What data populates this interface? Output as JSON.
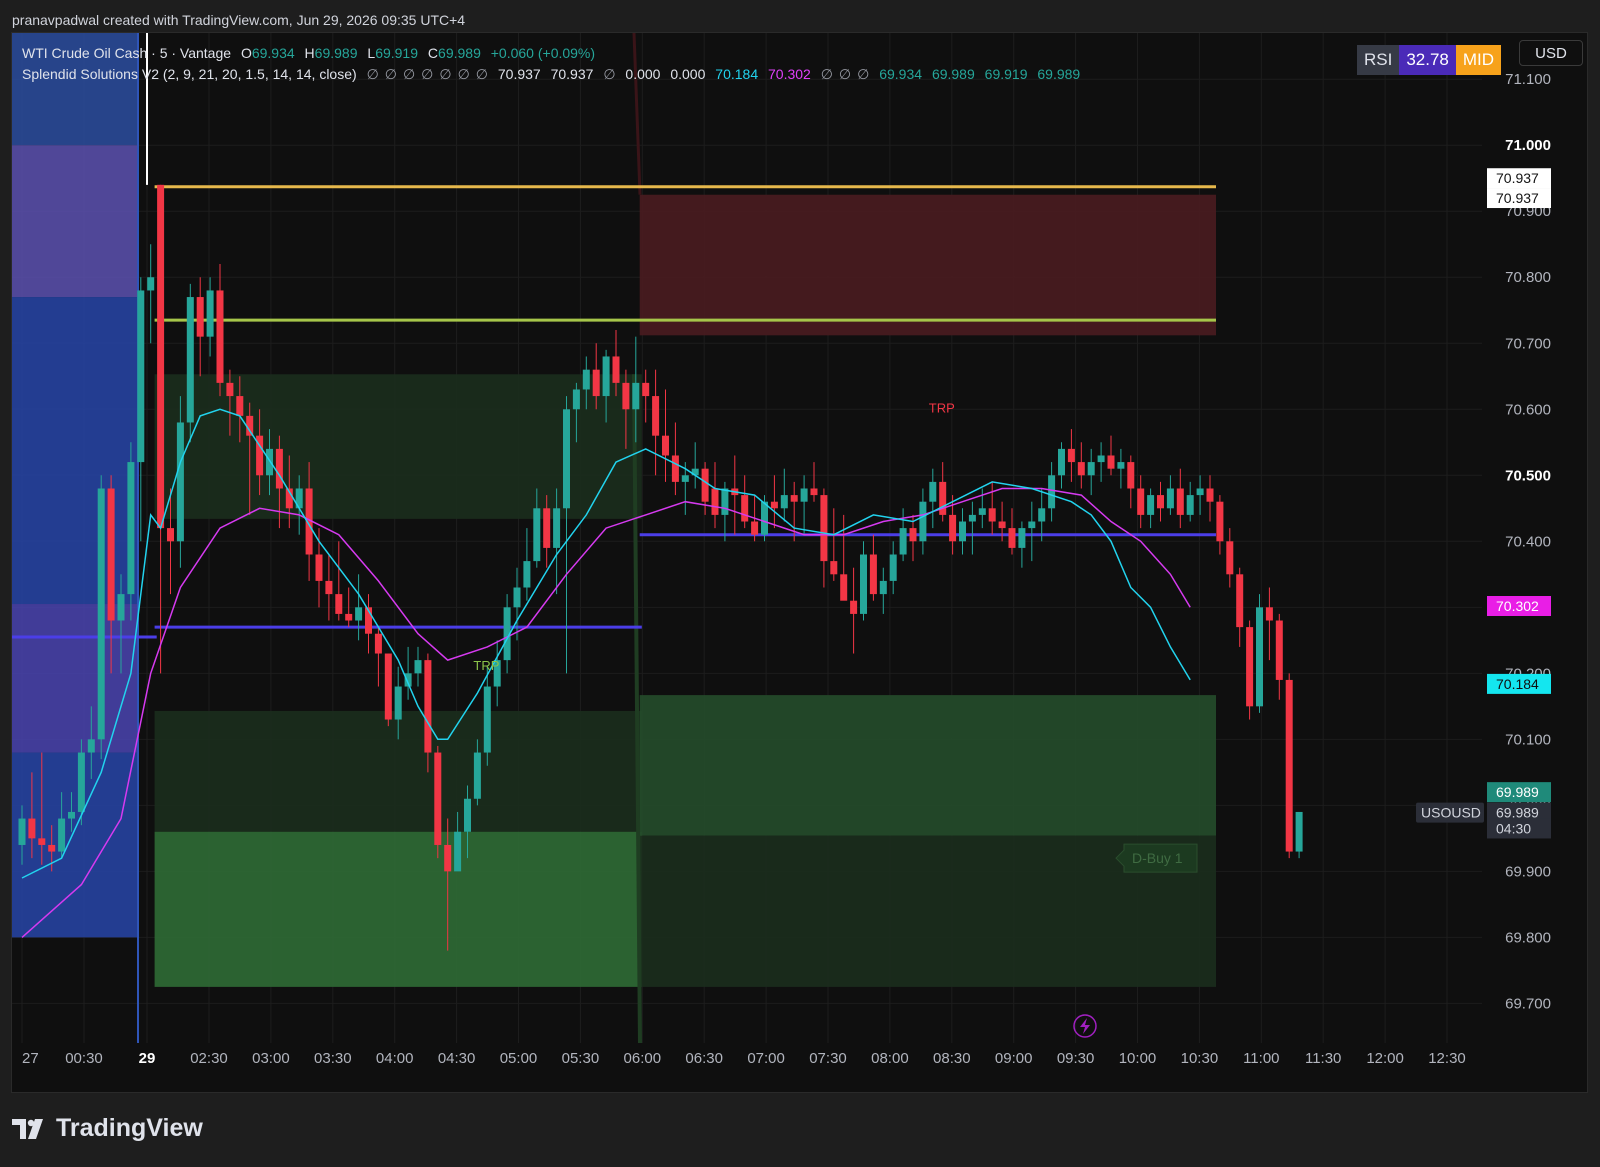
{
  "header": {
    "attribution": "pranavpadwal created with TradingView.com, Jun 29, 2026 09:35 UTC+4"
  },
  "legend": {
    "symbol": "WTI Crude Oil Cash · 5 · Vantage",
    "o_label": "O",
    "o": "69.934",
    "h_label": "H",
    "h": "69.989",
    "l_label": "L",
    "l": "69.919",
    "c_label": "C",
    "c": "69.989",
    "change": "+0.060 (+0.09%)",
    "indicator": "Splendid Solutions V2 (2, 9, 21, 20, 1.5, 14, 14, close)",
    "na": "∅",
    "v1": "70.937",
    "v2": "70.937",
    "v3": "0.000",
    "v4": "0.000",
    "v5": "70.184",
    "v6": "70.302",
    "v7": "69.934",
    "v8": "69.989",
    "v9": "69.919",
    "v10": "69.989"
  },
  "rsi_badge": {
    "label": "RSI",
    "value": "32.78",
    "state": "MID"
  },
  "currency_button": "USD",
  "brand": "TradingView",
  "colors": {
    "up": "#26a69a",
    "down": "#f23645",
    "ema_fast": "#22d3ee",
    "ema_slow": "#d63af0",
    "supply": "#4a1c20",
    "demand": "#2f6b35",
    "level_gold": "#e6b84c",
    "level_lime": "#a6c64a",
    "level_blue": "#4b3ee8"
  },
  "chart_data": {
    "type": "candlestick",
    "symbol": "USOUSD",
    "y_axis": {
      "ylim": [
        69.64,
        71.17
      ],
      "ticks": [
        "71.100",
        "71.000",
        "70.900",
        "70.800",
        "70.700",
        "70.600",
        "70.500",
        "70.400",
        "70.300",
        "70.200",
        "70.100",
        "70.000",
        "69.900",
        "69.800",
        "69.700"
      ]
    },
    "x_axis": {
      "ticks": [
        "27",
        "00:30",
        "29",
        "02:30",
        "03:00",
        "03:30",
        "04:00",
        "04:30",
        "05:00",
        "05:30",
        "06:00",
        "06:30",
        "07:00",
        "07:30",
        "08:00",
        "08:30",
        "09:00",
        "09:30",
        "10:00",
        "10:30",
        "11:00",
        "11:30",
        "12:00",
        "12:30"
      ]
    },
    "candles": [
      [
        69.94,
        70.0,
        69.91,
        69.98
      ],
      [
        69.98,
        70.05,
        69.92,
        69.95
      ],
      [
        69.95,
        70.08,
        69.91,
        69.94
      ],
      [
        69.94,
        69.97,
        69.9,
        69.93
      ],
      [
        69.93,
        70.02,
        69.92,
        69.98
      ],
      [
        69.98,
        70.02,
        69.96,
        69.99
      ],
      [
        69.99,
        70.1,
        69.97,
        70.08
      ],
      [
        70.08,
        70.15,
        70.04,
        70.1
      ],
      [
        70.1,
        70.5,
        70.07,
        70.48
      ],
      [
        70.48,
        70.5,
        70.2,
        70.28
      ],
      [
        70.28,
        70.35,
        70.2,
        70.32
      ],
      [
        70.32,
        70.55,
        70.28,
        70.52
      ],
      [
        70.52,
        70.8,
        70.4,
        70.78
      ],
      [
        70.78,
        70.85,
        70.7,
        70.8
      ],
      [
        70.94,
        70.94,
        70.2,
        70.42
      ],
      [
        70.42,
        70.48,
        70.32,
        70.4
      ],
      [
        70.4,
        70.62,
        70.36,
        70.58
      ],
      [
        70.58,
        70.79,
        70.55,
        70.77
      ],
      [
        70.77,
        70.8,
        70.65,
        70.71
      ],
      [
        70.71,
        70.8,
        70.68,
        70.78
      ],
      [
        70.78,
        70.82,
        70.62,
        70.64
      ],
      [
        70.64,
        70.66,
        70.56,
        70.62
      ],
      [
        70.62,
        70.65,
        70.55,
        70.59
      ],
      [
        70.59,
        70.61,
        70.44,
        70.56
      ],
      [
        70.56,
        70.6,
        70.47,
        70.5
      ],
      [
        70.5,
        70.57,
        70.47,
        70.54
      ],
      [
        70.54,
        70.56,
        70.42,
        70.48
      ],
      [
        70.48,
        70.53,
        70.42,
        70.45
      ],
      [
        70.45,
        70.5,
        70.41,
        70.48
      ],
      [
        70.48,
        70.52,
        70.34,
        70.38
      ],
      [
        70.38,
        70.42,
        70.3,
        70.34
      ],
      [
        70.34,
        70.38,
        70.28,
        70.32
      ],
      [
        70.32,
        70.4,
        70.28,
        70.29
      ],
      [
        70.29,
        70.33,
        70.27,
        70.28
      ],
      [
        70.28,
        70.35,
        70.25,
        70.3
      ],
      [
        70.3,
        70.32,
        70.23,
        70.26
      ],
      [
        70.26,
        70.27,
        70.18,
        70.23
      ],
      [
        70.23,
        70.23,
        70.12,
        70.13
      ],
      [
        70.13,
        70.21,
        70.1,
        70.18
      ],
      [
        70.18,
        70.24,
        70.16,
        70.2
      ],
      [
        70.2,
        70.24,
        70.18,
        70.22
      ],
      [
        70.22,
        70.23,
        70.05,
        70.08
      ],
      [
        70.08,
        70.09,
        69.92,
        69.94
      ],
      [
        69.94,
        69.98,
        69.78,
        69.9
      ],
      [
        69.9,
        69.99,
        69.92,
        69.96
      ],
      [
        69.96,
        70.03,
        69.92,
        70.01
      ],
      [
        70.01,
        70.1,
        70.0,
        70.08
      ],
      [
        70.08,
        70.21,
        70.06,
        70.18
      ],
      [
        70.18,
        70.25,
        70.15,
        70.22
      ],
      [
        70.22,
        70.32,
        70.2,
        70.3
      ],
      [
        70.3,
        70.36,
        70.25,
        70.33
      ],
      [
        70.33,
        70.42,
        70.31,
        70.37
      ],
      [
        70.37,
        70.48,
        70.36,
        70.45
      ],
      [
        70.45,
        70.47,
        70.36,
        70.39
      ],
      [
        70.39,
        70.48,
        70.32,
        70.45
      ],
      [
        70.45,
        70.62,
        70.2,
        70.6
      ],
      [
        70.6,
        70.64,
        70.55,
        70.63
      ],
      [
        70.63,
        70.68,
        70.6,
        70.66
      ],
      [
        70.66,
        70.7,
        70.6,
        70.62
      ],
      [
        70.62,
        70.69,
        70.58,
        70.68
      ],
      [
        70.68,
        70.72,
        70.62,
        70.64
      ],
      [
        70.64,
        70.66,
        70.54,
        70.6
      ],
      [
        70.6,
        70.71,
        70.55,
        70.64
      ],
      [
        70.64,
        70.66,
        70.58,
        70.62
      ],
      [
        70.62,
        70.66,
        70.5,
        70.56
      ],
      [
        70.56,
        70.63,
        70.49,
        70.53
      ],
      [
        70.53,
        70.58,
        70.47,
        70.49
      ],
      [
        70.49,
        70.52,
        70.44,
        70.5
      ],
      [
        70.5,
        70.55,
        70.48,
        70.51
      ],
      [
        70.51,
        70.52,
        70.44,
        70.46
      ],
      [
        70.48,
        70.52,
        70.42,
        70.44
      ],
      [
        70.44,
        70.49,
        70.4,
        70.48
      ],
      [
        70.48,
        70.53,
        70.41,
        70.47
      ],
      [
        70.47,
        70.5,
        70.42,
        70.43
      ],
      [
        70.43,
        70.47,
        70.4,
        70.41
      ],
      [
        70.41,
        70.47,
        70.4,
        70.46
      ],
      [
        70.46,
        70.5,
        70.42,
        70.45
      ],
      [
        70.45,
        70.51,
        70.43,
        70.47
      ],
      [
        70.47,
        70.49,
        70.4,
        70.46
      ],
      [
        70.46,
        70.5,
        70.41,
        70.48
      ],
      [
        70.48,
        70.52,
        70.46,
        70.47
      ],
      [
        70.47,
        70.48,
        70.33,
        70.37
      ],
      [
        70.37,
        70.45,
        70.34,
        70.35
      ],
      [
        70.35,
        70.44,
        70.32,
        70.31
      ],
      [
        70.31,
        70.36,
        70.23,
        70.29
      ],
      [
        70.29,
        70.4,
        70.28,
        70.38
      ],
      [
        70.38,
        70.41,
        70.31,
        70.32
      ],
      [
        70.32,
        70.36,
        70.29,
        70.34
      ],
      [
        70.34,
        70.4,
        70.32,
        70.38
      ],
      [
        70.38,
        70.45,
        70.37,
        70.42
      ],
      [
        70.42,
        70.44,
        70.37,
        70.4
      ],
      [
        70.4,
        70.48,
        70.38,
        70.46
      ],
      [
        70.46,
        70.51,
        70.42,
        70.49
      ],
      [
        70.49,
        70.52,
        70.43,
        70.44
      ],
      [
        70.44,
        70.47,
        70.38,
        70.4
      ],
      [
        70.4,
        70.45,
        70.38,
        70.43
      ],
      [
        70.43,
        70.46,
        70.38,
        70.44
      ],
      [
        70.44,
        70.48,
        70.42,
        70.45
      ],
      [
        70.45,
        70.49,
        70.41,
        70.43
      ],
      [
        70.43,
        70.46,
        70.4,
        70.42
      ],
      [
        70.42,
        70.45,
        70.38,
        70.39
      ],
      [
        70.39,
        70.43,
        70.36,
        70.42
      ],
      [
        70.42,
        70.46,
        70.37,
        70.43
      ],
      [
        70.43,
        70.48,
        70.4,
        70.45
      ],
      [
        70.45,
        70.52,
        70.43,
        70.5
      ],
      [
        70.5,
        70.55,
        70.48,
        70.54
      ],
      [
        70.54,
        70.57,
        70.49,
        70.52
      ],
      [
        70.52,
        70.55,
        70.48,
        70.5
      ],
      [
        70.5,
        70.54,
        70.47,
        70.52
      ],
      [
        70.52,
        70.55,
        70.49,
        70.53
      ],
      [
        70.53,
        70.56,
        70.5,
        70.51
      ],
      [
        70.51,
        70.54,
        70.48,
        70.52
      ],
      [
        70.52,
        70.53,
        70.45,
        70.48
      ],
      [
        70.48,
        70.5,
        70.42,
        70.44
      ],
      [
        70.44,
        70.48,
        70.42,
        70.47
      ],
      [
        70.47,
        70.49,
        70.43,
        70.45
      ],
      [
        70.45,
        70.5,
        70.44,
        70.48
      ],
      [
        70.48,
        70.51,
        70.42,
        70.44
      ],
      [
        70.44,
        70.49,
        70.43,
        70.47
      ],
      [
        70.47,
        70.5,
        70.44,
        70.48
      ],
      [
        70.48,
        70.5,
        70.43,
        70.46
      ],
      [
        70.46,
        70.47,
        70.38,
        70.4
      ],
      [
        70.4,
        70.42,
        70.33,
        70.35
      ],
      [
        70.35,
        70.36,
        70.24,
        70.27
      ],
      [
        70.27,
        70.28,
        70.13,
        70.15
      ],
      [
        70.15,
        70.32,
        70.14,
        70.3
      ],
      [
        70.3,
        70.33,
        70.22,
        70.28
      ],
      [
        70.28,
        70.29,
        70.16,
        70.19
      ],
      [
        70.19,
        70.2,
        69.92,
        69.93
      ],
      [
        69.93,
        69.99,
        69.92,
        69.99
      ]
    ],
    "ema_fast": [
      [
        0,
        69.89
      ],
      [
        4,
        69.92
      ],
      [
        8,
        70.05
      ],
      [
        11,
        70.2
      ],
      [
        13,
        70.44
      ],
      [
        14,
        70.42
      ],
      [
        16,
        70.52
      ],
      [
        18,
        70.59
      ],
      [
        20,
        70.6
      ],
      [
        22,
        70.59
      ],
      [
        26,
        70.5
      ],
      [
        30,
        70.4
      ],
      [
        34,
        70.32
      ],
      [
        38,
        70.22
      ],
      [
        40,
        70.15
      ],
      [
        42,
        70.1
      ],
      [
        43,
        70.1
      ],
      [
        46,
        70.17
      ],
      [
        50,
        70.28
      ],
      [
        54,
        70.38
      ],
      [
        57,
        70.44
      ],
      [
        60,
        70.52
      ],
      [
        63,
        70.54
      ],
      [
        67,
        70.51
      ],
      [
        70,
        70.48
      ],
      [
        74,
        70.47
      ],
      [
        78,
        70.42
      ],
      [
        82,
        70.41
      ],
      [
        86,
        70.44
      ],
      [
        90,
        70.43
      ],
      [
        94,
        70.46
      ],
      [
        98,
        70.49
      ],
      [
        102,
        70.48
      ],
      [
        106,
        70.46
      ],
      [
        108,
        70.44
      ],
      [
        110,
        70.4
      ],
      [
        112,
        70.33
      ],
      [
        114,
        70.3
      ],
      [
        116,
        70.24
      ],
      [
        118,
        70.19
      ]
    ],
    "ema_slow": [
      [
        0,
        69.8
      ],
      [
        6,
        69.88
      ],
      [
        10,
        69.98
      ],
      [
        13,
        70.2
      ],
      [
        16,
        70.33
      ],
      [
        20,
        70.42
      ],
      [
        24,
        70.45
      ],
      [
        28,
        70.44
      ],
      [
        32,
        70.41
      ],
      [
        36,
        70.34
      ],
      [
        40,
        70.26
      ],
      [
        43,
        70.22
      ],
      [
        47,
        70.24
      ],
      [
        51,
        70.27
      ],
      [
        55,
        70.35
      ],
      [
        59,
        70.42
      ],
      [
        63,
        70.44
      ],
      [
        67,
        70.46
      ],
      [
        71,
        70.45
      ],
      [
        75,
        70.43
      ],
      [
        79,
        70.41
      ],
      [
        83,
        70.41
      ],
      [
        87,
        70.43
      ],
      [
        91,
        70.44
      ],
      [
        95,
        70.46
      ],
      [
        99,
        70.48
      ],
      [
        103,
        70.48
      ],
      [
        107,
        70.47
      ],
      [
        110,
        70.43
      ],
      [
        113,
        70.4
      ],
      [
        116,
        70.35
      ],
      [
        118,
        70.3
      ]
    ],
    "price_tags": [
      {
        "text": "70.937",
        "value": 70.95,
        "kind": "white"
      },
      {
        "text": "70.937",
        "value": 70.92,
        "kind": "white"
      },
      {
        "text": "70.302",
        "value": 70.302,
        "kind": "magenta"
      },
      {
        "text": "70.184",
        "value": 70.184,
        "kind": "cyan"
      },
      {
        "text": "69.989",
        "value": 70.02,
        "kind": "green"
      },
      {
        "text": "69.989",
        "value": 69.989,
        "kind": "gray"
      },
      {
        "text": "04:30",
        "value": 69.965,
        "kind": "gray"
      }
    ],
    "symbol_tag": {
      "text": "USOUSD",
      "value": 69.989
    },
    "annotations": [
      {
        "text": "TRP",
        "index": 46,
        "value": 70.205,
        "color": "#8bc34a"
      },
      {
        "text": "TRP",
        "index": 92,
        "value": 70.595,
        "color": "#f23645"
      }
    ],
    "signal_label": {
      "text": "D-Buy 1",
      "value": 69.92
    },
    "levels": [
      {
        "value": 70.937,
        "from": 14,
        "to": 120,
        "color": "gold"
      },
      {
        "value": 70.735,
        "from": 14,
        "to": 120,
        "color": "lime"
      },
      {
        "value": 70.27,
        "from": 14,
        "to": 62,
        "color": "blue"
      },
      {
        "value": 70.41,
        "from": 63,
        "to": 120,
        "color": "blue"
      },
      {
        "value": 70.255,
        "from": 0,
        "to": 13,
        "color": "blue"
      }
    ],
    "zones": [
      {
        "kind": "supply",
        "from": 63,
        "to": 120,
        "top": 70.925,
        "bottom": 70.712
      },
      {
        "kind": "demand_dim",
        "from": 14,
        "to": 62,
        "top": 70.653,
        "bottom": 70.434
      },
      {
        "kind": "demand_dim",
        "from": 14,
        "to": 62,
        "top": 70.143,
        "bottom": 69.96
      },
      {
        "kind": "demand",
        "from": 14,
        "to": 62,
        "top": 69.96,
        "bottom": 69.725
      },
      {
        "kind": "demand_mid",
        "from": 63,
        "to": 120,
        "top": 70.167,
        "bottom": 69.954
      },
      {
        "kind": "demand_dim",
        "from": 63,
        "to": 120,
        "top": 69.954,
        "bottom": 69.725
      }
    ],
    "blue_zones": [
      {
        "top": 71.17,
        "bottom": 71.0,
        "shade": "#2c4da0"
      },
      {
        "top": 71.0,
        "bottom": 70.77,
        "shade": "#5c51b0"
      },
      {
        "top": 70.77,
        "bottom": 70.305,
        "shade": "#2745a8"
      },
      {
        "top": 70.305,
        "bottom": 70.08,
        "shade": "#4a44b0"
      },
      {
        "top": 70.08,
        "bottom": 69.8,
        "shade": "#2745a8"
      }
    ]
  }
}
